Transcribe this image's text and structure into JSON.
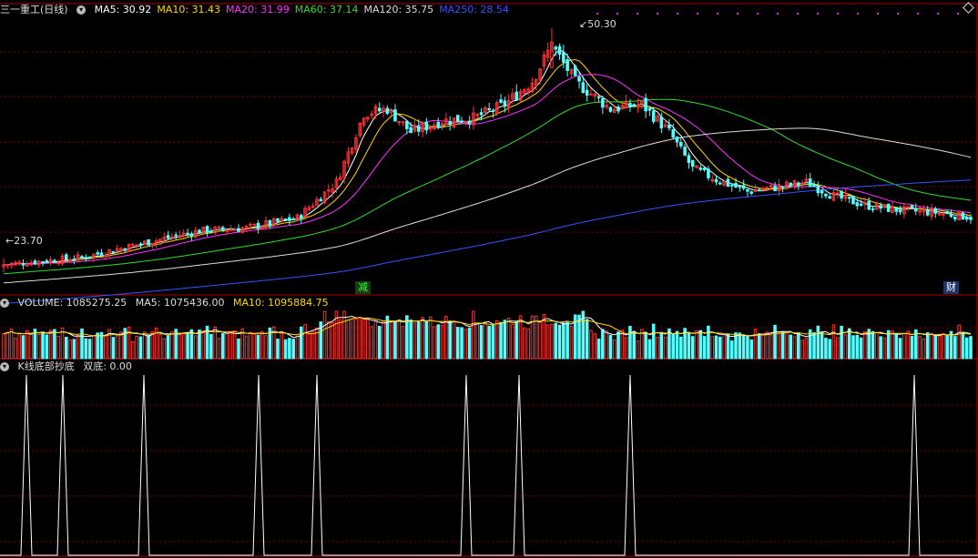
{
  "header": {
    "title": "三一重工(日线)",
    "ma": [
      {
        "label": "MA5: 30.92",
        "color": "#ffffff"
      },
      {
        "label": "MA10: 31.43",
        "color": "#ffd800"
      },
      {
        "label": "MA20: 31.99",
        "color": "#ff33ff"
      },
      {
        "label": "MA60: 37.14",
        "color": "#33dd33"
      },
      {
        "label": "MA120: 35.75",
        "color": "#dddddd"
      },
      {
        "label": "MA250: 28.54",
        "color": "#3355ff"
      }
    ]
  },
  "volume_header": {
    "label": "VOLUME: 1085275.25",
    "ma5": "MA5: 1075436.00",
    "ma10": "MA10: 1095884.75"
  },
  "indicator_header": {
    "label": "K线底部抄底",
    "value": "双底: 0.00"
  },
  "annotations": {
    "peak": "50.30",
    "low": "23.70",
    "flag1": "减",
    "flag2": "财"
  },
  "colors": {
    "up": "#ff3333",
    "down": "#54ffff",
    "grid": "#7a0000",
    "border": "#b00000",
    "ma5": "#ffffff",
    "ma10": "#ffd800",
    "ma20": "#ff33ff",
    "ma60": "#33dd33",
    "ma120": "#dddddd",
    "ma250": "#3355ff"
  },
  "chart_data": [
    {
      "type": "candlestick",
      "ylim": [
        22,
        51
      ],
      "keypoints": [
        [
          0,
          24.5
        ],
        [
          20,
          25.3
        ],
        [
          35,
          26.8
        ],
        [
          50,
          28.2
        ],
        [
          62,
          28.5
        ],
        [
          75,
          29.6
        ],
        [
          85,
          33.5
        ],
        [
          92,
          41.0
        ],
        [
          98,
          41.5
        ],
        [
          104,
          39.0
        ],
        [
          112,
          40.2
        ],
        [
          120,
          40.5
        ],
        [
          128,
          42.0
        ],
        [
          135,
          44.5
        ],
        [
          140,
          48.5
        ],
        [
          146,
          44.5
        ],
        [
          155,
          41.5
        ],
        [
          163,
          42.0
        ],
        [
          170,
          39.0
        ],
        [
          176,
          35.0
        ],
        [
          182,
          33.8
        ],
        [
          190,
          32.5
        ],
        [
          198,
          33.0
        ],
        [
          205,
          33.5
        ],
        [
          212,
          32.0
        ],
        [
          220,
          31.0
        ],
        [
          228,
          30.5
        ],
        [
          238,
          30.2
        ],
        [
          247,
          29.7
        ]
      ],
      "bars": 248,
      "peak": 50.3,
      "low": 23.7,
      "last": {
        "ma5": 30.92,
        "ma10": 31.43,
        "ma20": 31.99,
        "ma60": 37.14,
        "ma120": 35.75,
        "ma250": 28.54
      }
    },
    {
      "type": "bar",
      "name": "VOLUME",
      "last": 1085275.25,
      "ma5": 1075436.0,
      "ma10": 1095884.75
    },
    {
      "type": "line",
      "name": "双底",
      "last": 0.0,
      "signal_bars": [
        8,
        18,
        46,
        82,
        100,
        147,
        163,
        195,
        283
      ]
    }
  ]
}
